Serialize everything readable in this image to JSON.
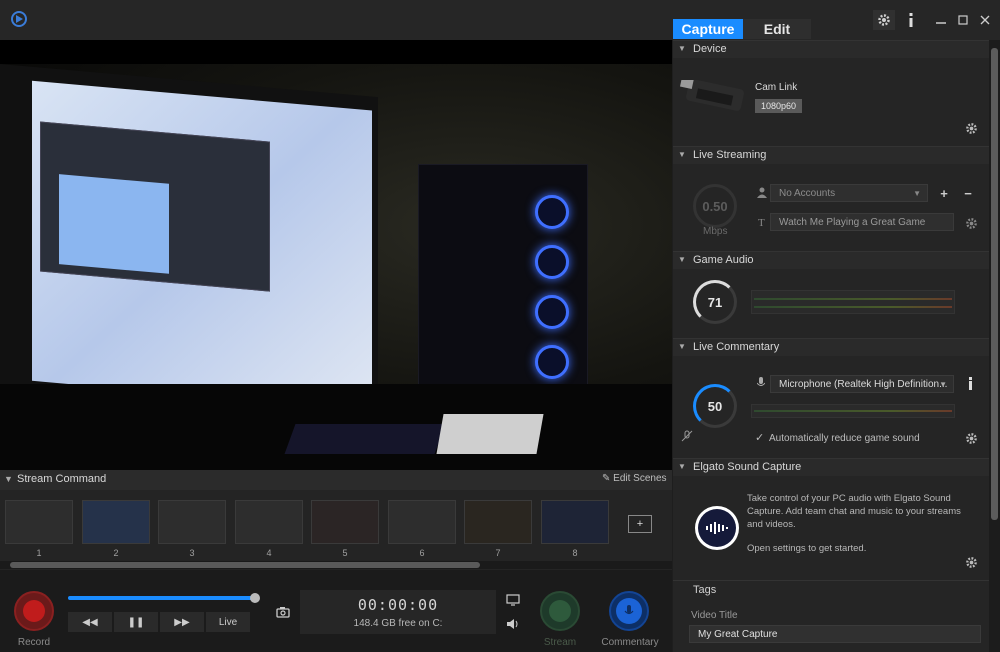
{
  "tabs": {
    "capture": "Capture",
    "edit": "Edit"
  },
  "stream_command": {
    "title": "Stream Command",
    "edit_scenes": "Edit Scenes",
    "scenes": [
      "1",
      "2",
      "3",
      "4",
      "5",
      "6",
      "7",
      "8"
    ]
  },
  "playback": {
    "progress_fraction": 0.97,
    "rewind": "◀◀",
    "pause": "❚❚",
    "forward": "▶▶",
    "live": "Live",
    "timer": "00:00:00",
    "free_space": "148.4 GB free on C:",
    "record_label": "Record",
    "stream_label": "Stream",
    "commentary_label": "Commentary"
  },
  "device": {
    "section": "Device",
    "name": "Cam Link",
    "resolution": "1080p60"
  },
  "live_streaming": {
    "section": "Live Streaming",
    "bitrate_value": "0.50",
    "bitrate_unit": "Mbps",
    "accounts_placeholder": "No Accounts",
    "title_value": "Watch Me Playing a Great Game",
    "add": "+",
    "remove": "−"
  },
  "game_audio": {
    "section": "Game Audio",
    "level": "71"
  },
  "live_commentary": {
    "section": "Live Commentary",
    "level": "50",
    "microphone": "Microphone (Realtek High Definition...",
    "auto_reduce": "Automatically reduce game sound",
    "auto_reduce_checked": true
  },
  "sound_capture": {
    "section": "Elgato Sound Capture",
    "description": "Take control of your PC audio with Elgato Sound Capture. Add team chat and music to your streams and videos.",
    "cta": "Open settings to get started."
  },
  "tags": {
    "section": "Tags",
    "video_title_label": "Video Title",
    "video_title_value": "My Great Capture"
  },
  "colors": {
    "accent": "#1a8cff",
    "record": "#c01c1c",
    "commentary": "#1b63d6"
  }
}
